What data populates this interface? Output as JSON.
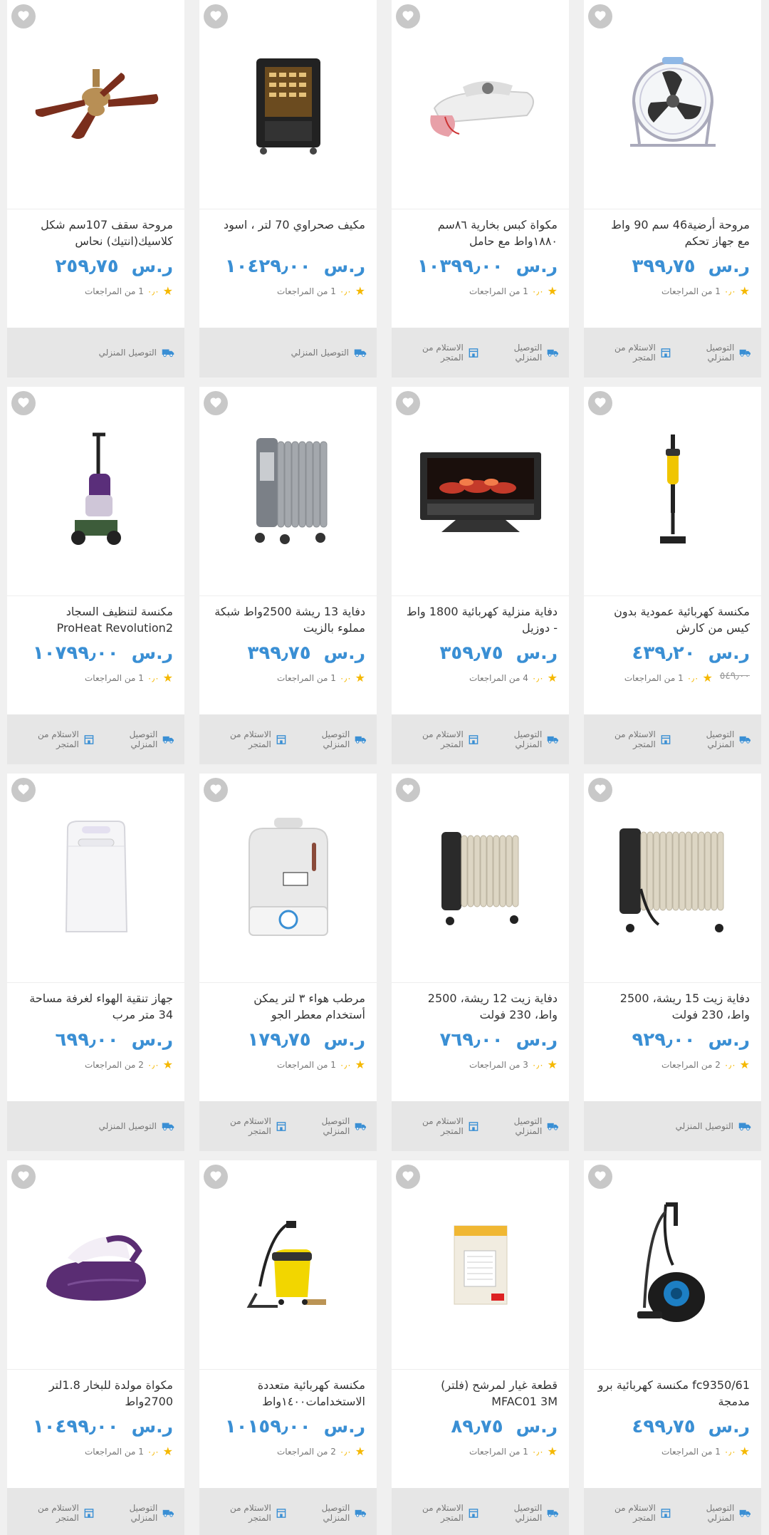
{
  "currency": "ر.س",
  "delivery_label": "التوصيل المنزلي",
  "pickup_label": "الاستلام من المتجر",
  "reviews_suffix": "من المراجعات",
  "colors": {
    "price": "#3a8fd4",
    "star": "#f5b800",
    "footer_bg": "#e6e6e6"
  },
  "products": [
    {
      "title": "مروحة أرضية46 سم 90 واط مع جهاز تحكم",
      "price": "٣٩٩٫٧٥",
      "score": "٠٫٠",
      "reviews": "1",
      "old_price": "",
      "delivery": true,
      "pickup": true,
      "image": "floor-fan"
    },
    {
      "title": "مكواة كبس بخارية ٨٦سم ١٨٨٠واط مع حامل",
      "price": "١٠٣٩٩٫٠٠",
      "score": "٠٫٠",
      "reviews": "1",
      "old_price": "",
      "delivery": true,
      "pickup": true,
      "image": "steam-press"
    },
    {
      "title": "مكيف صحراوي 70 لتر ، اسود",
      "price": "١٠٤٢٩٫٠٠",
      "score": "٠٫٠",
      "reviews": "1",
      "old_price": "",
      "delivery": true,
      "pickup": false,
      "image": "desert-cooler"
    },
    {
      "title": "مروحة سقف 107سم شكل كلاسيك(انتيك) نحاس",
      "price": "٢٥٩٫٧٥",
      "score": "٠٫٠",
      "reviews": "1",
      "old_price": "",
      "delivery": true,
      "pickup": false,
      "image": "ceiling-fan"
    },
    {
      "title": "مكنسة كهربائية عمودية بدون كيس من كارش",
      "price": "٤٣٩٫٢٠",
      "score": "٠٫٠",
      "reviews": "1",
      "old_price": "٥٤٩٫٠٠",
      "delivery": true,
      "pickup": true,
      "image": "stick-vacuum"
    },
    {
      "title": "دفاية منزلية كهربائية 1800 واط - دوزيل",
      "price": "٣٥٩٫٧٥",
      "score": "٠٫٠",
      "reviews": "4",
      "old_price": "",
      "delivery": true,
      "pickup": true,
      "image": "fireplace"
    },
    {
      "title": "دفاية 13 ريشة 2500واط شبكة مملوء بالزيت",
      "price": "٣٩٩٫٧٥",
      "score": "٠٫٠",
      "reviews": "1",
      "old_price": "",
      "delivery": true,
      "pickup": true,
      "image": "oil-heater-grey"
    },
    {
      "title": "مكنسة لتنظيف السجاد ProHeat Revolution2",
      "price": "١٠٧٩٩٫٠٠",
      "score": "٠٫٠",
      "reviews": "1",
      "old_price": "",
      "delivery": true,
      "pickup": true,
      "image": "carpet-cleaner"
    },
    {
      "title": "دفاية زيت 15 ريشة، 2500 واط، 230 فولت",
      "price": "٩٢٩٫٠٠",
      "score": "٠٫٠",
      "reviews": "2",
      "old_price": "",
      "delivery": true,
      "pickup": false,
      "image": "oil-heater-15"
    },
    {
      "title": "دفاية زيت 12 ريشة، 2500 واط، 230 فولت",
      "price": "٧٦٩٫٠٠",
      "score": "٠٫٠",
      "reviews": "3",
      "old_price": "",
      "delivery": true,
      "pickup": true,
      "image": "oil-heater-12"
    },
    {
      "title": "مرطب هواء ٣ لتر يمكن أستخدام معطر الجو",
      "price": "١٧٩٫٧٥",
      "score": "٠٫٠",
      "reviews": "1",
      "old_price": "",
      "delivery": true,
      "pickup": true,
      "image": "humidifier"
    },
    {
      "title": "جهاز تنقية الهواء لغرفة مساحة 34 متر مرب",
      "price": "٦٩٩٫٠٠",
      "score": "٠٫٠",
      "reviews": "2",
      "old_price": "",
      "delivery": true,
      "pickup": false,
      "image": "air-purifier"
    },
    {
      "title": "fc9350/61 مكنسة كهربائية برو مدمجة",
      "price": "٤٩٩٫٧٥",
      "score": "٠٫٠",
      "reviews": "1",
      "old_price": "",
      "delivery": true,
      "pickup": true,
      "image": "canister-vacuum"
    },
    {
      "title": "قطعة غيار لمرشح (فلتر) MFAC01 3M",
      "price": "٨٩٫٧٥",
      "score": "٠٫٠",
      "reviews": "1",
      "old_price": "",
      "delivery": true,
      "pickup": true,
      "image": "filter-box"
    },
    {
      "title": "مكنسة كهربائية متعددة الاستخدامات١٤٠٠واط",
      "price": "١٠١٥٩٫٠٠",
      "score": "٠٫٠",
      "reviews": "2",
      "old_price": "",
      "delivery": true,
      "pickup": true,
      "image": "wet-dry-vacuum"
    },
    {
      "title": "مكواة مولدة للبخار 1.8لتر 2700واط",
      "price": "١٠٤٩٩٫٠٠",
      "score": "٠٫٠",
      "reviews": "1",
      "old_price": "",
      "delivery": true,
      "pickup": true,
      "image": "steam-generator-iron"
    }
  ]
}
